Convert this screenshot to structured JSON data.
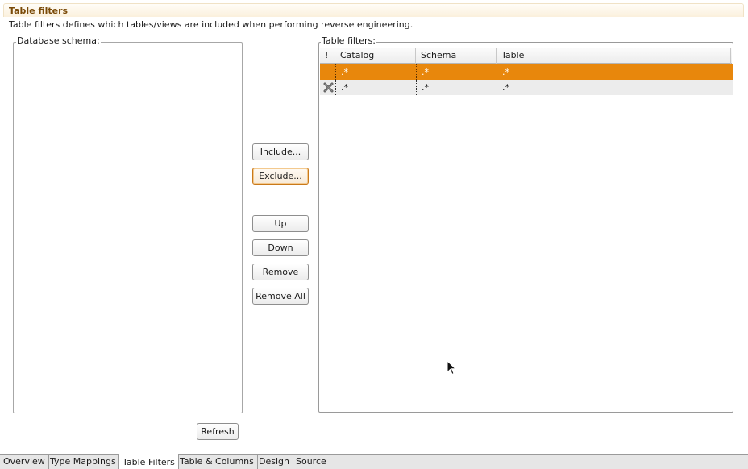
{
  "section": {
    "title": "Table filters",
    "description": "Table filters defines which tables/views are included when performing reverse engineering."
  },
  "schema_panel": {
    "label": "Database schema:",
    "refresh_label": "Refresh"
  },
  "buttons": {
    "include": "Include...",
    "exclude": "Exclude...",
    "up": "Up",
    "down": "Down",
    "remove": "Remove",
    "remove_all": "Remove All"
  },
  "filters_panel": {
    "label": "Table filters:",
    "columns": [
      "!",
      "Catalog",
      "Schema",
      "Table"
    ],
    "rows": [
      {
        "flag": "",
        "catalog": ".*",
        "schema": ".*",
        "table": ".*",
        "selected": true
      },
      {
        "flag": "exclude-icon",
        "catalog": ".*",
        "schema": ".*",
        "table": ".*",
        "selected": false
      }
    ]
  },
  "tabs": [
    {
      "label": "Overview",
      "active": false
    },
    {
      "label": "Type Mappings",
      "active": false
    },
    {
      "label": "Table Filters",
      "active": true
    },
    {
      "label": "Table & Columns",
      "active": false
    },
    {
      "label": "Design",
      "active": false
    },
    {
      "label": "Source",
      "active": false
    }
  ],
  "colors": {
    "selection": "#e8870c",
    "title": "#7a4a08",
    "focus_border": "#c9791a"
  }
}
